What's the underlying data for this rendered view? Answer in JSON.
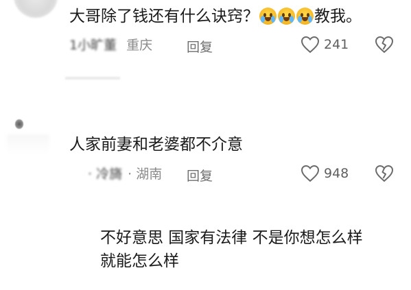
{
  "comments": [
    {
      "text_before": "大哥除了钱还有什么诀窍？",
      "emoji_name": "crying-laughing-emoji",
      "emoji_count": 3,
      "text_after": "教我。",
      "username": "1小旷董",
      "location": "重庆",
      "reply_label": "回复",
      "likes": "241"
    },
    {
      "text": "人家前妻和老婆都不介意",
      "username": "· 冷旖",
      "location": "· 湖南",
      "reply_label": "回复",
      "likes": "948"
    }
  ],
  "reply_text": {
    "line1": "不好意思 国家有法律 不是你想怎么样",
    "line2": "就能怎么样"
  },
  "icons": {
    "like": "heart-outline-icon",
    "dislike": "broken-heart-icon"
  },
  "colors": {
    "text": "#1a1a1a",
    "meta": "#8a8a8a",
    "icon": "#6b6b6b"
  }
}
